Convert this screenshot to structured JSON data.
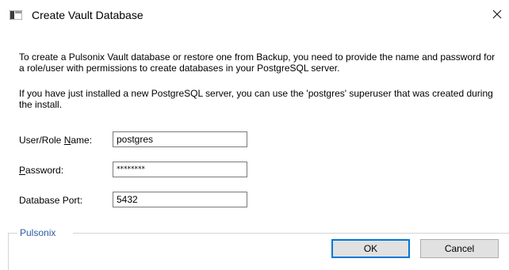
{
  "window": {
    "title": "Create Vault Database",
    "icon": "app-window-icon",
    "close_icon": "close-icon"
  },
  "intro": {
    "paragraph1": "To create a Pulsonix Vault database or restore one from Backup, you need to provide the name and password for a role/user with permissions to create databases in your PostgreSQL server.",
    "paragraph2": "If you have just installed a new PostgreSQL server, you can use the 'postgres' superuser that was created during the install."
  },
  "form": {
    "username": {
      "label_pre": "User/Role ",
      "label_accel": "N",
      "label_post": "ame:",
      "value": "postgres"
    },
    "password": {
      "label_pre": "",
      "label_accel": "P",
      "label_post": "assword:",
      "value": "********"
    },
    "port": {
      "label": "Database Port:",
      "value": "5432"
    }
  },
  "group": {
    "label": "Pulsonix"
  },
  "buttons": {
    "ok": "OK",
    "cancel": "Cancel"
  },
  "colors": {
    "group_label": "#2b5aa3",
    "default_button_border": "#0078d7",
    "button_face": "#e1e1e1"
  }
}
